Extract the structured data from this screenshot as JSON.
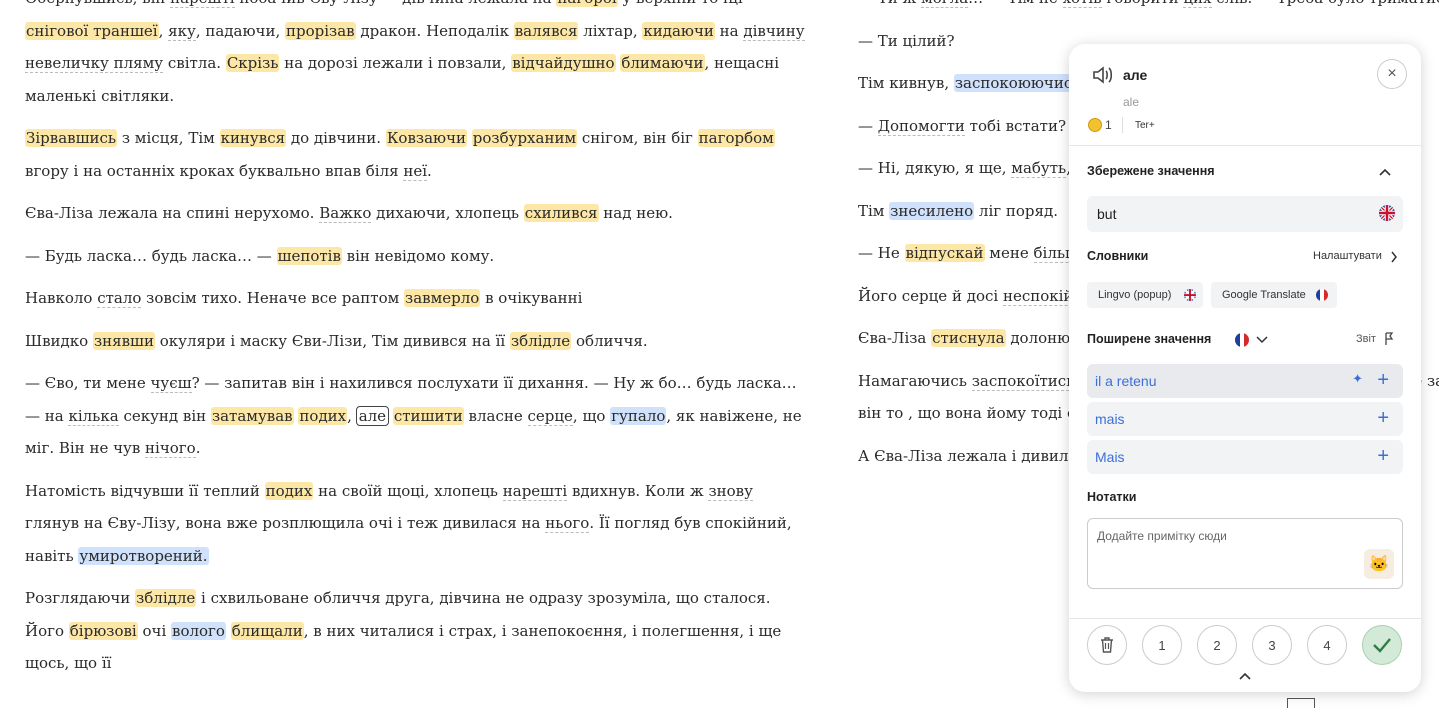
{
  "left_paragraphs": [
    [
      {
        "t": "Обернувшись, він "
      },
      {
        "t": "нарешті",
        "c": "w"
      },
      {
        "t": " побачив Єву-Лізу — дівчина лежала на "
      },
      {
        "t": "пагорбі",
        "c": "hy"
      },
      {
        "t": " у верхній точці "
      },
      {
        "t": "снігової траншеї",
        "c": "hy"
      },
      {
        "t": ", "
      },
      {
        "t": "яку",
        "c": "w"
      },
      {
        "t": ", падаючи, "
      },
      {
        "t": "прорізав",
        "c": "hy"
      },
      {
        "t": " дракон.  Неподалік "
      },
      {
        "t": "валявся",
        "c": "hy"
      },
      {
        "t": " ліхтар, "
      },
      {
        "t": "кидаючи",
        "c": "hy"
      },
      {
        "t": " на "
      },
      {
        "t": "дівчину невеличку пляму",
        "c": "w"
      },
      {
        "t": " світла.  "
      },
      {
        "t": "Скрізь",
        "c": "hy"
      },
      {
        "t": " на дорозі лежали і повзали, "
      },
      {
        "t": "відчайдушно",
        "c": "hy"
      },
      {
        "t": " "
      },
      {
        "t": "блимаючи",
        "c": "hy"
      },
      {
        "t": ", нещасні маленькі світляки."
      }
    ],
    [
      {
        "t": "Зірвавшись",
        "c": "hy"
      },
      {
        "t": " з місця, Тім "
      },
      {
        "t": "кинувся",
        "c": "hy"
      },
      {
        "t": " до дівчини.  "
      },
      {
        "t": "Ковзаючи",
        "c": "hy"
      },
      {
        "t": " "
      },
      {
        "t": "розбурханим",
        "c": "hy"
      },
      {
        "t": " снігом, він біг "
      },
      {
        "t": "пагорбом",
        "c": "hy"
      },
      {
        "t": " вгору і на останніх кроках буквально впав біля "
      },
      {
        "t": "неї",
        "c": "w"
      },
      {
        "t": "."
      }
    ],
    [
      {
        "t": "Єва-Ліза лежала на спині нерухомо.  "
      },
      {
        "t": "Важко",
        "c": "w"
      },
      {
        "t": " дихаючи, хлопець "
      },
      {
        "t": "схилився",
        "c": "hy"
      },
      {
        "t": " над нею."
      }
    ],
    [
      {
        "t": "— Будь ласка… будь ласка… — "
      },
      {
        "t": "шепотів",
        "c": "hy"
      },
      {
        "t": " він невідомо кому."
      }
    ],
    [
      {
        "t": "Навколо "
      },
      {
        "t": "стало",
        "c": "w"
      },
      {
        "t": " зовсім тихо.  Неначе все раптом "
      },
      {
        "t": "завмерло",
        "c": "hy"
      },
      {
        "t": " в очікуванні"
      }
    ],
    [
      {
        "t": "Швидко "
      },
      {
        "t": "знявши",
        "c": "hy"
      },
      {
        "t": " окуляри і маску Єви-Лізи, Тім дивився на її "
      },
      {
        "t": "зблідле",
        "c": "hy"
      },
      {
        "t": " обличчя."
      }
    ],
    [
      {
        "t": "— Єво, ти мене "
      },
      {
        "t": "чуєш",
        "c": "w"
      },
      {
        "t": "?  — запитав він і нахилився послухати її дихання.  — Ну ж бо… будь ласка… — на "
      },
      {
        "t": "кілька",
        "c": "w"
      },
      {
        "t": " секунд він "
      },
      {
        "t": "затамував",
        "c": "hy"
      },
      {
        "t": " "
      },
      {
        "t": "подих",
        "c": "hy"
      },
      {
        "t": ", "
      },
      {
        "t": "але",
        "c": "sel"
      },
      {
        "t": " "
      },
      {
        "t": "стишити",
        "c": "hy"
      },
      {
        "t": " власне "
      },
      {
        "t": "серце",
        "c": "w"
      },
      {
        "t": ", що "
      },
      {
        "t": "гупало",
        "c": "hb"
      },
      {
        "t": ", як навіжене, не міг.  Він не чув "
      },
      {
        "t": "нічого",
        "c": "w"
      },
      {
        "t": "."
      }
    ],
    [
      {
        "t": "Натомість відчувши її теплий "
      },
      {
        "t": "подих",
        "c": "hy"
      },
      {
        "t": " на своїй щоці, хлопець "
      },
      {
        "t": "нарешті",
        "c": "w"
      },
      {
        "t": " вдихнув.  Коли ж "
      },
      {
        "t": "знову",
        "c": "w"
      },
      {
        "t": " глянув на Єву-Лізу, вона вже розплющила очі і теж дивилася на "
      },
      {
        "t": "нього",
        "c": "w"
      },
      {
        "t": ".  Її погляд був спокійний, навіть "
      },
      {
        "t": "умиротворений.",
        "c": "hb"
      }
    ],
    [
      {
        "t": "Розглядаючи "
      },
      {
        "t": "зблідле",
        "c": "hy"
      },
      {
        "t": " і схвильоване обличчя друга, дівчина не одразу зрозуміла, що сталося.  Його "
      },
      {
        "t": "бірюзові",
        "c": "hy"
      },
      {
        "t": " очі "
      },
      {
        "t": "волого",
        "c": "hb"
      },
      {
        "t": " "
      },
      {
        "t": "блищали",
        "c": "hy"
      },
      {
        "t": ", в них читалися і страх, і занепокоєння, і полегшення, і ще щось, що її"
      }
    ]
  ],
  "right_paragraphs": [
    [
      {
        "t": "— Ти ж "
      },
      {
        "t": "могла",
        "c": "w"
      },
      {
        "t": "… — Тім не "
      },
      {
        "t": "хотів",
        "c": "w"
      },
      {
        "t": " говорити "
      },
      {
        "t": "цих",
        "c": "w"
      },
      {
        "t": " слів.  — Треба було триматися!"
      }
    ],
    [
      {
        "t": "— Ти цілий?"
      }
    ],
    [
      {
        "t": "Тім кивнув, "
      },
      {
        "t": "заспокоюючись",
        "c": "hb"
      }
    ],
    [
      {
        "t": "— "
      },
      {
        "t": "Допомогти",
        "c": "w"
      },
      {
        "t": " тобі встати?  —"
      }
    ],
    [
      {
        "t": "— Ні, дякую, я ще, "
      },
      {
        "t": "мабуть",
        "c": "w"
      },
      {
        "t": ", п"
      }
    ],
    [
      {
        "t": "Тім "
      },
      {
        "t": "знесилено",
        "c": "hb"
      },
      {
        "t": " ліг поряд."
      }
    ],
    [
      {
        "t": "— Не "
      },
      {
        "t": "відпускай",
        "c": "hy"
      },
      {
        "t": " мене "
      },
      {
        "t": "більш",
        "c": "w"
      }
    ],
    [
      {
        "t": "Його серце й досі "
      },
      {
        "t": "неспокійн",
        "c": "w"
      },
      {
        "t": " "
      },
      {
        "t": "заболіло",
        "c": "hb"
      },
      {
        "t": " у грудях і сил не ли"
      }
    ],
    [
      {
        "t": "Єва-Ліза "
      },
      {
        "t": "стиснула",
        "c": "hy"
      },
      {
        "t": " долоню "
      },
      {
        "t": " бачив, дівчина дивилася н"
      }
    ],
    [
      {
        "t": "Намагаючись "
      },
      {
        "t": "заспокоїтись",
        "c": "w"
      },
      {
        "t": " про маму — тієї розмови ві реальністю  Але зараз він то , що вона йому тоді сказала"
      }
    ],
    [
      {
        "t": "А Єва-Ліза лежала і дивила схвильована  За мить вона "
      }
    ]
  ],
  "popup": {
    "word": "але",
    "transliteration": "ale",
    "coins": "1",
    "hotkey": "Ter+",
    "close_icon": "×",
    "saved_section_title": "Збережене значення",
    "saved_value": "but",
    "dictionaries_title": "Словники",
    "settings_label": "Налаштувати",
    "dictionaries": [
      "Lingvo (popup)",
      "Google Translate"
    ],
    "common_meanings_title": "Поширене значення",
    "report_label": "Звіт",
    "meanings": [
      "il a retenu",
      "mais",
      "Mais"
    ],
    "notes_title": "Нотатки",
    "note_placeholder": "Додайте примітку сюди",
    "levels": [
      "1",
      "2",
      "3",
      "4"
    ],
    "accent_color": "#3b6fd8",
    "ok_color": "#2e7d45",
    "icons": [
      "speaker-icon",
      "close-icon",
      "chevron-up-icon",
      "uk-flag-icon",
      "fr-flag-icon",
      "chevron-right-icon",
      "chevron-down-icon",
      "report-flag-icon",
      "sparkle-icon",
      "plus-icon",
      "cat-avatar-icon",
      "trash-icon",
      "check-icon"
    ]
  }
}
